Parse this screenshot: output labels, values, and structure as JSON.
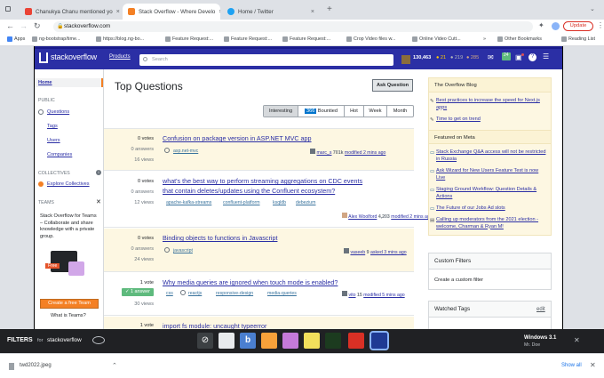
{
  "browser": {
    "tabs": [
      {
        "label": "Chanukya Chanu mentioned yo",
        "close": "×"
      },
      {
        "label": "Stack Overflow - Where Develo",
        "close": "×"
      },
      {
        "label": "Home / Twitter",
        "close": "×"
      }
    ],
    "new_tab": "+",
    "url": "stackoverflow.com",
    "update_label": "Update",
    "bookmarks": [
      "Apps",
      "ng-bootstrap/time...",
      "https://blog.ng-bo...",
      "Feature Request:...",
      "Feature Request:...",
      "Feature Request:...",
      "Crop Video files w...",
      "Online Video Cutt..."
    ],
    "other_bookmarks": "Other Bookmarks",
    "reading_list": "Reading List"
  },
  "so": {
    "logo": "stackoverflow",
    "products": "Products",
    "search_placeholder": "Search",
    "rep": "130,463",
    "gold": "● 21",
    "silver": "● 219",
    "bronze": "● 285",
    "inbox_badge": "24"
  },
  "nav": {
    "home": "Home",
    "public": "PUBLIC",
    "questions": "Questions",
    "tags": "Tags",
    "users": "Users",
    "companies": "Companies",
    "collectives": "COLLECTIVES",
    "explore": "Explore Collectives",
    "teams": "TEAMS",
    "teams_blurb": "Stack Overflow for Teams – Collaborate and share knowledge with a private group.",
    "free": "Free",
    "create_team": "Create a free Team",
    "what_teams": "What is Teams?"
  },
  "main": {
    "heading": "Top Questions",
    "ask": "Ask Question",
    "filters": [
      "Interesting",
      "366",
      "Bountied",
      "Hot",
      "Week",
      "Month"
    ],
    "questions": [
      {
        "votes": "0 votes",
        "answers": "0 answers",
        "views": "16 views",
        "title": [
          "Confusion on package version in ASP.NET MVC app"
        ],
        "tags": [
          "asp.net-mvc"
        ],
        "user": "marc_s",
        "rep": "701k",
        "when": "modified 2 mins ago"
      },
      {
        "votes": "0 votes",
        "answers": "0 answers",
        "views": "12 views",
        "title": [
          "what's the best way to perform streaming aggregations on CDC events",
          "that contain deletes/updates using the Confluent ecosystem?"
        ],
        "tags": [
          "apache-kafka-streams",
          "confluent-platform",
          "ksqldb",
          "debezium"
        ],
        "user": "Alex Woolford",
        "rep": "4,203",
        "when": "modified 2 mins ago"
      },
      {
        "votes": "0 votes",
        "answers": "0 answers",
        "views": "24 views",
        "title": [
          "Binding objects to functions in Javascript"
        ],
        "tags": [
          "javascript"
        ],
        "user": "vaseeb",
        "rep": "9",
        "when": "asked 3 mins ago"
      },
      {
        "votes": "1 vote",
        "answers": "✓ 1 answer",
        "views": "30 views",
        "title": [
          "Why media queries are ignored when touch mode is enabled?"
        ],
        "tags": [
          "css",
          "reactjs",
          "responsive-design",
          "media-queries"
        ],
        "user": "vito",
        "rep": "15",
        "when": "modified 5 mins ago"
      },
      {
        "votes": "1 vote",
        "answers": "",
        "views": "",
        "title": [
          "import fs module: uncaught typeerror"
        ],
        "tags": [],
        "user": "",
        "rep": "",
        "when": ""
      }
    ]
  },
  "sidebar": {
    "blog_head": "The Overflow Blog",
    "blog_items": [
      "Best practices to increase the speed for Next.js apps",
      "Time to get on trend"
    ],
    "meta_head": "Featured on Meta",
    "meta_items": [
      "Stack Exchange Q&A access will not be restricted in Russia",
      "Ask Wizard for New Users Feature Test is now Live",
      "Staging Ground Workflow: Question Details & Actions",
      "The Future of our Jobs Ad slots",
      "Calling up moderators from the 2021 election - welcome, Charman & Ryan M!"
    ],
    "custom_head": "Custom Filters",
    "custom_link": "Create a custom filter",
    "watched_head": "Watched Tags",
    "watched_edit": "edit"
  },
  "filters_bar": {
    "brand": "FILTERS",
    "for": "for",
    "site": "stackoverflow",
    "theme_title": "Windows 3.1",
    "theme_author": "Mr. Doe",
    "close": "✕"
  },
  "downloads": {
    "file": "twd2022.jpeg",
    "chevron": "⌃",
    "show_all": "Show all",
    "close": "✕"
  },
  "colors": {
    "so_blue": "#2b2fa5",
    "highlight": "#fdf7e2",
    "accepted": "#5eba7d"
  }
}
